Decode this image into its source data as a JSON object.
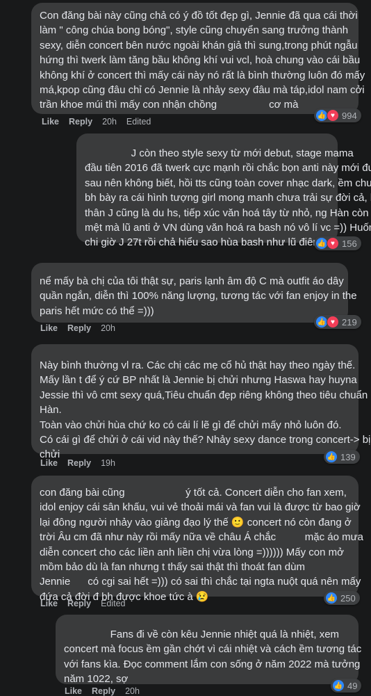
{
  "comments": [
    {
      "lines": [
        "Con đăng bài này cũng chả có ý đồ tốt đẹp gì, Jennie đã qua cái thời",
        "làm \" công chúa bong bóng\", style cũng chuyển sang trưởng thành",
        "sexy, diễn concert bên nước ngoài khán giả thì sung,trong phút ngẫu",
        "hứng thì twerk làm tăng bầu không khí vui vcl, hoà chung vào cái bầu",
        "không khí ở concert thì mấy cái này nó rất là bình thường luôn đó mấy",
        "má,kpop cũng đâu chỉ có Jennie là nhảy sexy đâu mà táp,idol nam cởi",
        "trần khoe múi thì mấy con nhận chồng                  cơ mà"
      ],
      "like": "Like",
      "reply": "Reply",
      "time": "20h",
      "edited": "Edited",
      "reactions": "994",
      "heart": true
    },
    {
      "lines": [
        "                J còn theo style sexy từ mới debut, stage mama",
        "đầu tiên 2016 đã twerk cực mạnh rồi chắc bọn anti này mới đu",
        "sau nên không biết, hồi tts cũng toàn cover nhạc dark, ềm chưa",
        "bh bày ra cái hình tượng girl mong manh chưa trải sự đời cả, bản",
        "thân J cũng là du hs, tiếp xúc văn hoá tây từ nhỏ, ng Hàn còn mê",
        "mệt mà lũ anti ở VN dùng văn hoá ra bash nó vô lí vc =)) Huống",
        "chi giờ J 27t rồi chả hiểu sao hùa bash như lũ điên ấy"
      ],
      "like": "",
      "reply": "",
      "time": "",
      "edited": "",
      "reactions": "156",
      "heart": true
    },
    {
      "lines": [
        "nể mấy bà chị của tôi thật sự, paris lạnh âm độ C mà outfit áo dây",
        "quần ngắn, diễn thì 100% năng lượng, tương tác với fan enjoy in the",
        "paris hết mức có thể =)))"
      ],
      "like": "Like",
      "reply": "Reply",
      "time": "20h",
      "edited": "",
      "reactions": "219",
      "heart": true
    },
    {
      "lines": [
        "Này bình thường vl ra. Các chị các mẹ cổ hủ thật hay theo ngày thế.",
        "Mấy lần t để ý cứ BP nhất là Jennie bị chửi nhưng Haswa hay huyna",
        "Jessie thì vô cmt sexy quá,Tiêu chuẩn đẹp riêng không theo tiêu chuẩn",
        "Hàn.",
        "Toàn vào chửi hùa chứ ko có cái lí lẽ gì để chửi mấy nhỏ luôn đó.",
        "Có cái gì để chửi ở cái vid này thế? Nhảy sexy dance trong concert-> bị",
        "chửi"
      ],
      "like": "Like",
      "reply": "Reply",
      "time": "19h",
      "edited": "",
      "reactions": "139",
      "heart": false
    },
    {
      "lines": [
        "con đăng bài cũng                     ý tốt cả. Concert diễn cho fan xem,",
        "idol enjoy cái sân khấu, vui vẻ thoải mái và fan vui là được từ bao giờ",
        "lại đông người nhảy vào giảng đạo lý thế 🙂 concert nó còn đang ở",
        "trời Âu cm đã như này rồi mấy nữa về châu Á chắc          mặc áo mưa",
        "diễn concert cho các liền anh liền chị vừa lòng =)))))) Mấy con mở",
        "mồm bảo dù là fan nhưng t thấy sai thật thì thoát fan dùm",
        "Jennie      có cgi sai hết =))) có sai thì chắc tại ngta nuột quá nên mấy",
        "đứa cả đời đ bh được khoe tức à 😢"
      ],
      "like": "Like",
      "reply": "Reply",
      "time": "",
      "edited": "Edited",
      "reactions": "250",
      "heart": false
    },
    {
      "lines": [
        "                Fans đi về còn kêu Jennie nhiệt quá là nhiệt, xem",
        "concert mà focus ềm gần chớt vì cái nhiệt và cách ềm tương tác",
        "với fans kìa. Đọc comment lắm con sống ở năm 2022 mà tưởng",
        "năm 1022, sợ"
      ],
      "like": "Like",
      "reply": "Reply",
      "time": "20h",
      "edited": "",
      "reactions": "49",
      "heart": false
    }
  ],
  "colors": {
    "background": "#18191a",
    "bubble": "#3a3b3c",
    "text": "#e4e6eb",
    "secondary": "#b0b3b8",
    "like_blue": "#2d88ff",
    "heart_red": "#f33e58"
  },
  "icons": {
    "like": "like-icon",
    "heart": "heart-icon"
  }
}
